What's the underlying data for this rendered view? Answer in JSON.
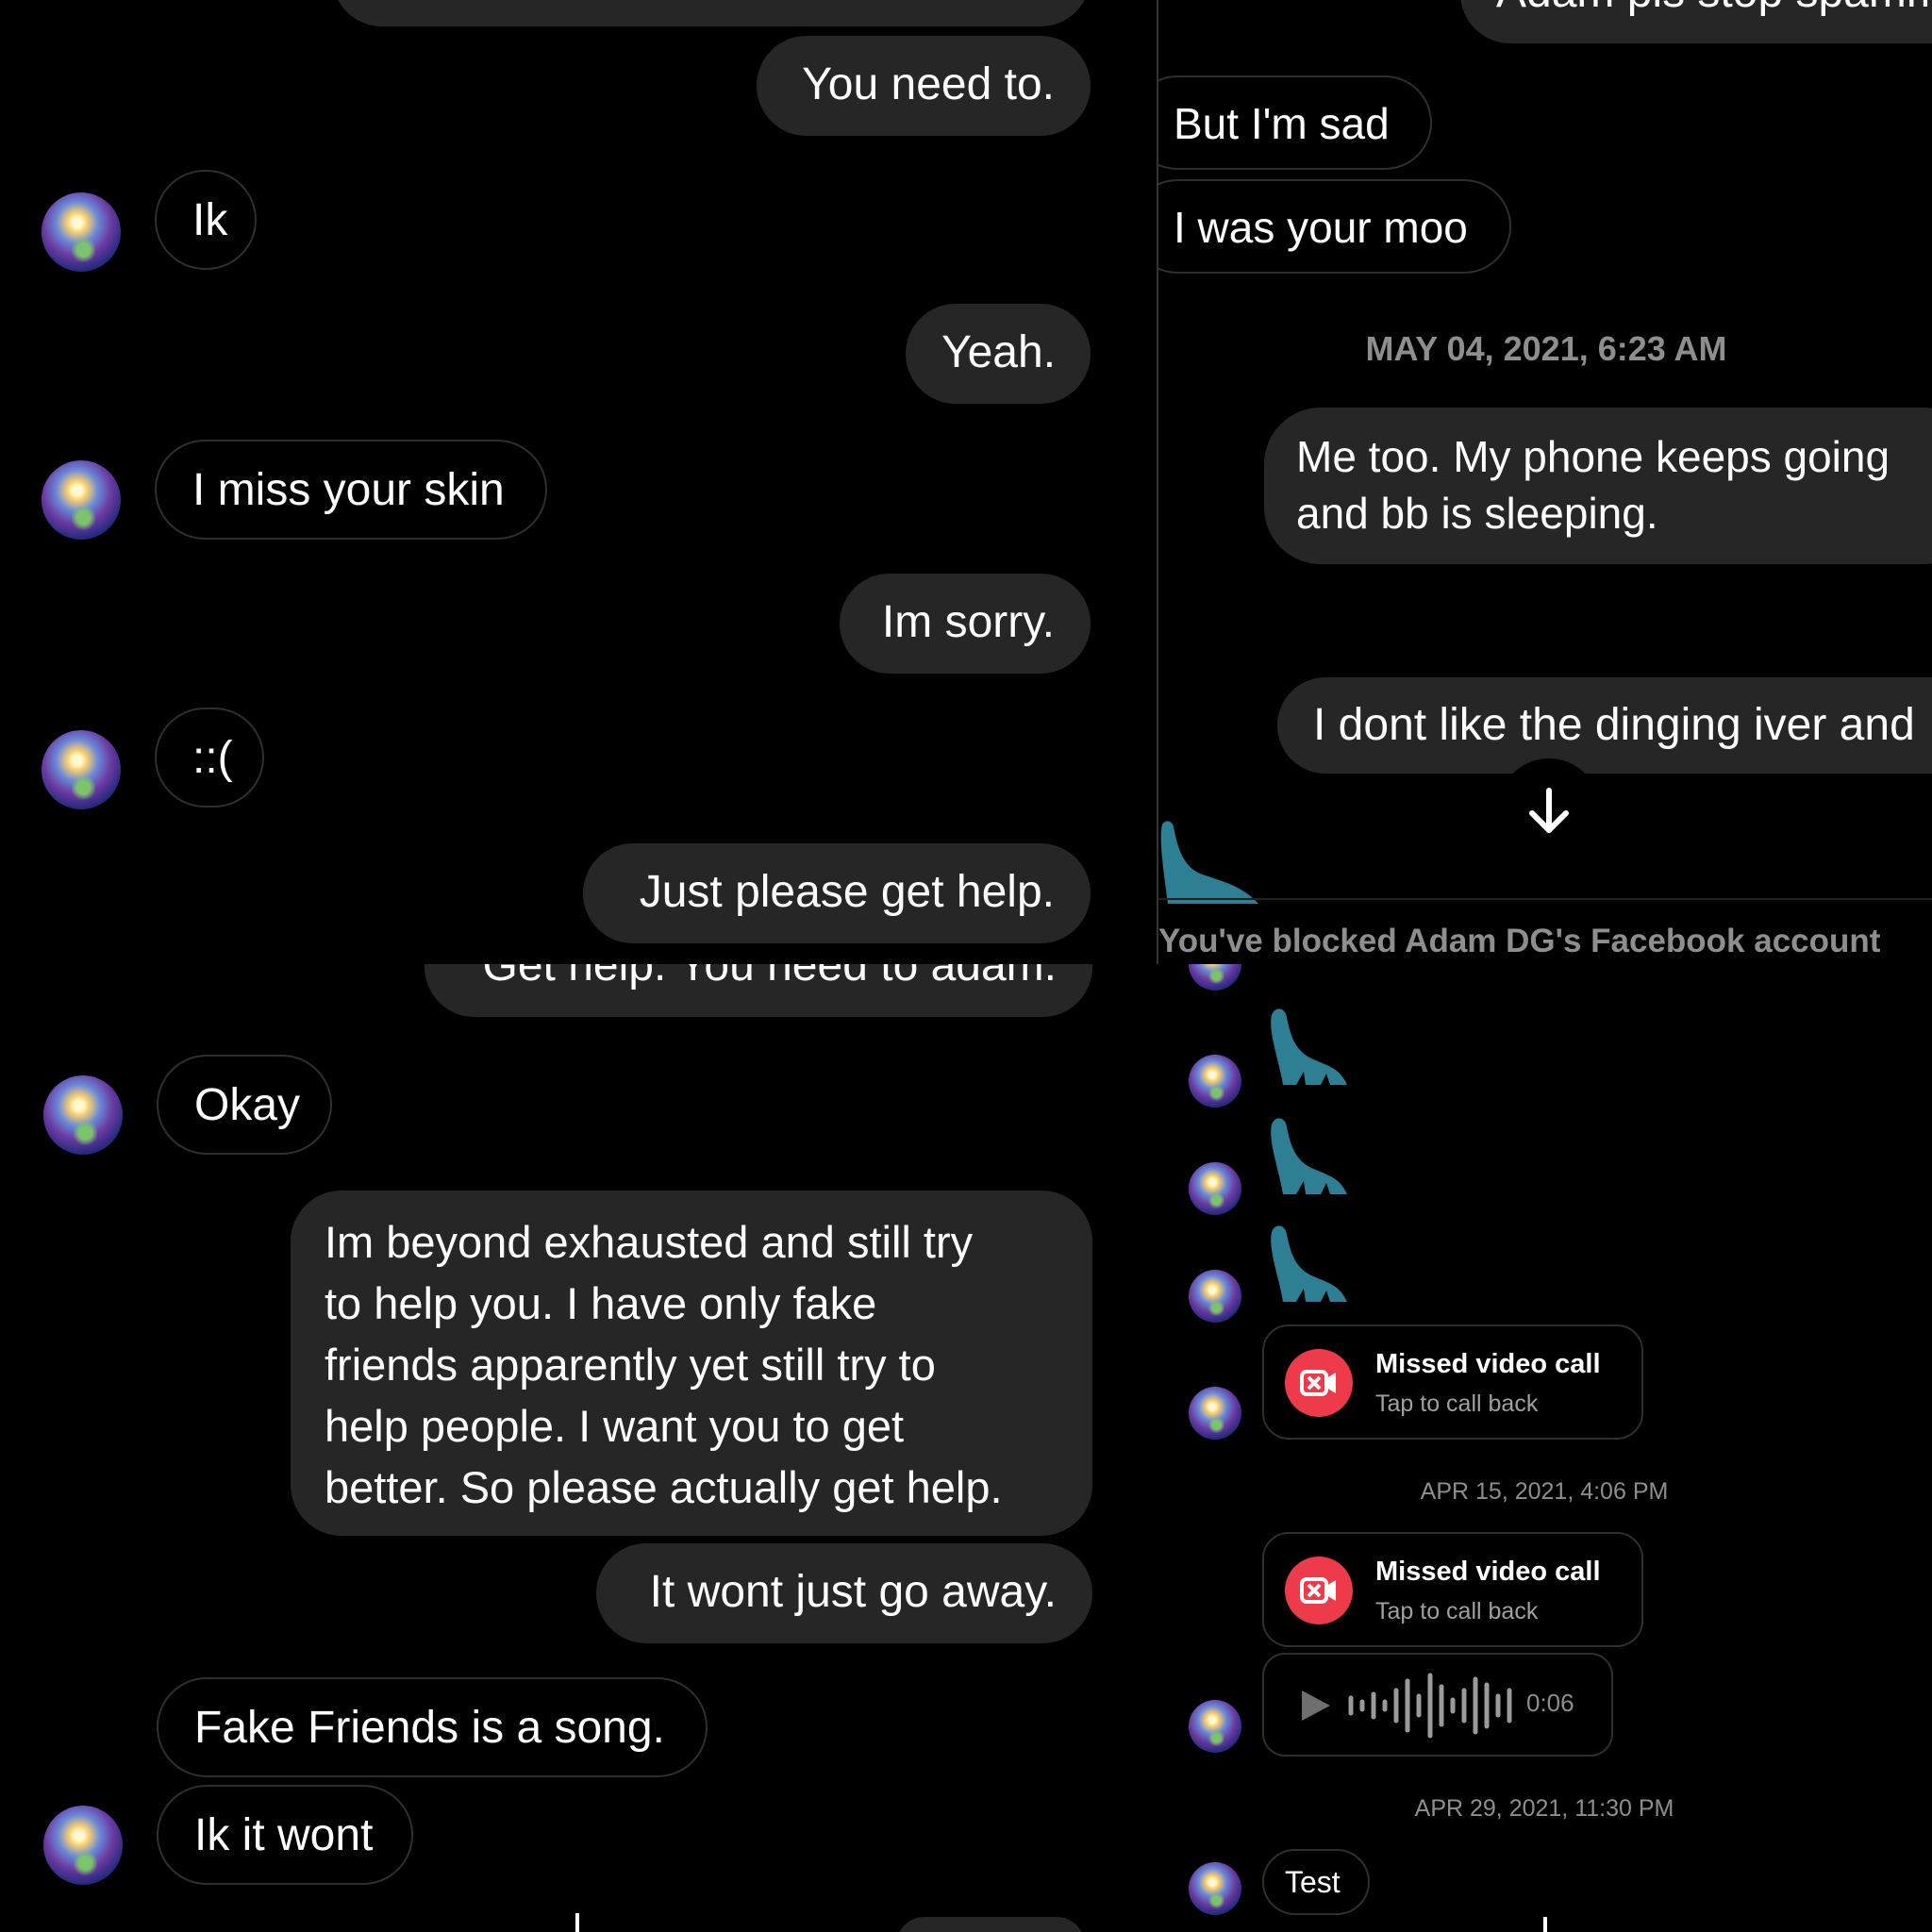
{
  "top_left": {
    "partial_top": "",
    "messages": [
      {
        "side": "sent",
        "text": "You need to."
      },
      {
        "side": "recv",
        "text": "Ik"
      },
      {
        "side": "sent",
        "text": "Yeah."
      },
      {
        "side": "recv",
        "text": "I miss your skin"
      },
      {
        "side": "sent",
        "text": "Im sorry."
      },
      {
        "side": "recv",
        "text": "::("
      },
      {
        "side": "sent",
        "text": "Just please get help."
      }
    ]
  },
  "bottom_left": {
    "partial_top": "Get help. You need to adam.",
    "messages": [
      {
        "side": "recv",
        "text": "Okay"
      },
      {
        "side": "sent",
        "lines": [
          "Im beyond exhausted and still try",
          "to help you. I have only fake",
          "friends apparently yet still try to",
          "help people. I want you to get",
          "better. So please actually get help."
        ]
      },
      {
        "side": "sent",
        "text": "It wont just go away."
      },
      {
        "side": "recv",
        "text": "Fake Friends is a song."
      },
      {
        "side": "recv",
        "text": "Ik it wont"
      }
    ]
  },
  "top_right": {
    "partial_top": "Adam pls stop spamm",
    "messages": [
      {
        "side": "recv",
        "text": "But I'm sad"
      },
      {
        "side": "recv",
        "text": "I was your moo"
      }
    ],
    "timestamp": "MAY 04, 2021, 6:23 AM",
    "sent_multi": [
      "Me too. My phone keeps going",
      "and bb is sleeping."
    ],
    "sent_partial": "I dont like the dinging iver and",
    "scroll_down_icon": "arrow-down-icon",
    "blocked_notice": "You've blocked Adam DG's Facebook account"
  },
  "bottom_right": {
    "dinos": [
      "dinosaur-sticker",
      "dinosaur-sticker",
      "dinosaur-sticker"
    ],
    "missed_call_1": {
      "title": "Missed video call",
      "sub": "Tap to call back"
    },
    "timestamp_1": "APR 15, 2021, 4:06 PM",
    "missed_call_2": {
      "title": "Missed video call",
      "sub": "Tap to call back"
    },
    "voice": {
      "duration": "0:06"
    },
    "timestamp_2": "APR 29, 2021, 11:30 PM",
    "test_msg": "Test"
  },
  "colors": {
    "background": "#000000",
    "sent_bubble": "#262626",
    "received_border": "#2f2f2f",
    "timestamp": "#8e8e8e",
    "missed_call": "#ee3b4b"
  }
}
